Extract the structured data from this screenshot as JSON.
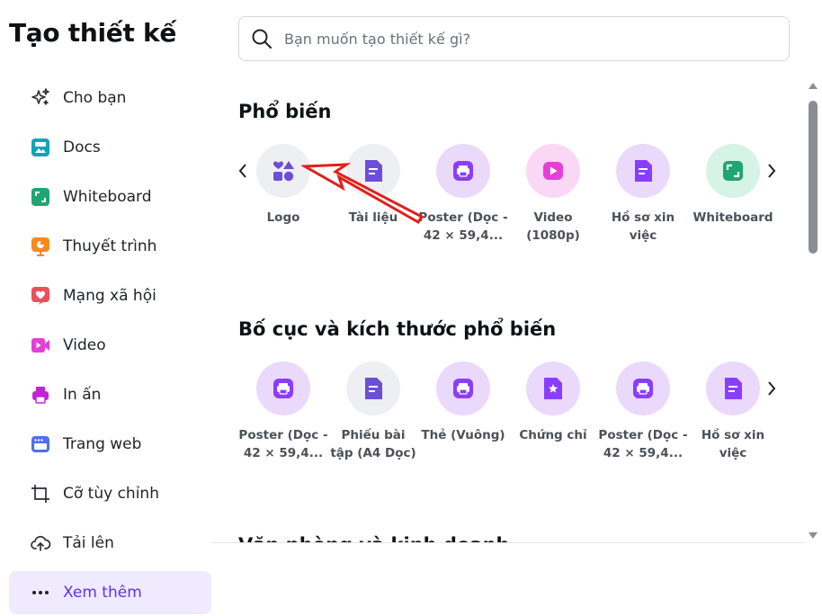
{
  "sidebar": {
    "title": "Tạo thiết kế",
    "items": [
      {
        "label": "Cho bạn",
        "icon": "sparkle-icon"
      },
      {
        "label": "Docs",
        "icon": "docs-icon"
      },
      {
        "label": "Whiteboard",
        "icon": "whiteboard-icon"
      },
      {
        "label": "Thuyết trình",
        "icon": "presentation-icon"
      },
      {
        "label": "Mạng xã hội",
        "icon": "heart-icon"
      },
      {
        "label": "Video",
        "icon": "video-icon"
      },
      {
        "label": "In ấn",
        "icon": "printer-icon"
      },
      {
        "label": "Trang web",
        "icon": "website-icon"
      },
      {
        "label": "Cỡ tùy chỉnh",
        "icon": "crop-icon"
      },
      {
        "label": "Tải lên",
        "icon": "upload-cloud-icon"
      },
      {
        "label": "Xem thêm",
        "icon": "more-dots-icon"
      }
    ]
  },
  "search": {
    "placeholder": "Bạn muốn tạo thiết kế gì?"
  },
  "sections": [
    {
      "title": "Phổ biến",
      "tiles": [
        {
          "line1": "Logo",
          "line2": "",
          "icon": "shapes-icon",
          "bg": "#eeeff2"
        },
        {
          "line1": "Tài liệu",
          "line2": "",
          "icon": "document-icon",
          "bg": "#eeeff2"
        },
        {
          "line1": "Poster (Dọc -",
          "line2": "42 × 59,4...",
          "icon": "printer-icon",
          "bg": "#ead9fb"
        },
        {
          "line1": "Video",
          "line2": "(1080p)",
          "icon": "play-icon",
          "bg": "#f9d7f5"
        },
        {
          "line1": "Hồ sơ xin",
          "line2": "việc",
          "icon": "document-icon",
          "bg": "#ead9fb"
        },
        {
          "line1": "Whiteboard",
          "line2": "",
          "icon": "whiteboard-icon",
          "bg": "#d5f3e6"
        }
      ]
    },
    {
      "title": "Bố cục và kích thước phổ biến",
      "tiles": [
        {
          "line1": "Poster (Dọc -",
          "line2": "42 × 59,4...",
          "icon": "printer-icon",
          "bg": "#ead9fb"
        },
        {
          "line1": "Phiếu bài",
          "line2": "tập (A4 Dọc)",
          "icon": "document-icon",
          "bg": "#eeeff2"
        },
        {
          "line1": "Thẻ (Vuông)",
          "line2": "",
          "icon": "printer-icon",
          "bg": "#ead9fb"
        },
        {
          "line1": "Chứng chỉ",
          "line2": "",
          "icon": "certificate-icon",
          "bg": "#ead9fb"
        },
        {
          "line1": "Poster (Dọc -",
          "line2": "42 × 59,4...",
          "icon": "printer-icon",
          "bg": "#ead9fb"
        },
        {
          "line1": "Hồ sơ xin",
          "line2": "việc",
          "icon": "document-icon",
          "bg": "#ead9fb"
        }
      ]
    },
    {
      "title": "Văn phòng và kinh doanh"
    }
  ],
  "colors": {
    "accent": "#5a32fa",
    "active_bg": "#efeafe",
    "purple_icon": "#8b3dff",
    "indigo_icon": "#6d4ed8",
    "pink_icon": "#e43fd6",
    "green_icon": "#1ea672",
    "annotation_red": "#e0201b"
  }
}
